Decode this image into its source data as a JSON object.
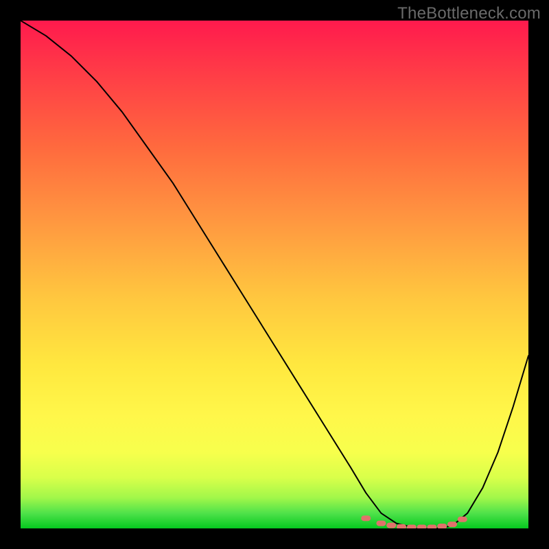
{
  "watermark": "TheBottleneck.com",
  "chart_data": {
    "type": "line",
    "title": "",
    "xlabel": "",
    "ylabel": "",
    "xlim": [
      0,
      100
    ],
    "ylim": [
      0,
      100
    ],
    "series": [
      {
        "name": "bottleneck-curve",
        "x": [
          0,
          5,
          10,
          15,
          20,
          25,
          30,
          35,
          40,
          45,
          50,
          55,
          60,
          65,
          68,
          71,
          74,
          78,
          82,
          85,
          88,
          91,
          94,
          97,
          100
        ],
        "values": [
          100,
          97,
          93,
          88,
          82,
          75,
          68,
          60,
          52,
          44,
          36,
          28,
          20,
          12,
          7,
          3,
          1,
          0,
          0,
          0.5,
          3,
          8,
          15,
          24,
          34
        ]
      }
    ],
    "markers": {
      "name": "optimal-range",
      "x": [
        68,
        71,
        73,
        75,
        77,
        79,
        81,
        83,
        85,
        87
      ],
      "values": [
        2,
        1,
        0.6,
        0.3,
        0.2,
        0.2,
        0.2,
        0.4,
        0.8,
        1.8
      ]
    },
    "gradient_colors": {
      "top": "#ff1a4d",
      "mid_high": "#ff9940",
      "mid": "#ffe83f",
      "low": "#05c81f"
    }
  }
}
